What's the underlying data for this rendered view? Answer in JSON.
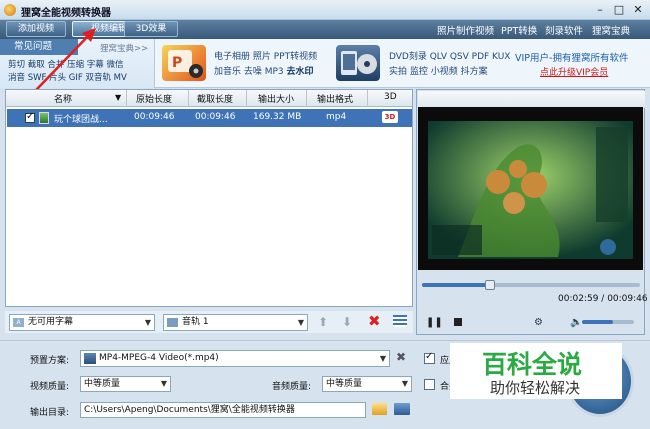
{
  "window": {
    "title": "狸窝全能视频转换器"
  },
  "toolbar": {
    "buttons": [
      "添加视频",
      "视频编辑",
      "3D效果"
    ],
    "links": [
      "照片制作视频",
      "PPT转换",
      "刻录软件",
      "狸窝宝典"
    ]
  },
  "faq": {
    "tab": "常见问题",
    "link": "狸窝宝典>>",
    "line1": "剪切 截取 合并 压缩 字幕 微信",
    "line2": "消音 SWF 片头 GIF 双音轨 MV"
  },
  "promo": {
    "a_line1": "电子相册 照片 PPT转视频",
    "a_line2a": "加音乐 去噪 MP3",
    "a_line2b": "去水印",
    "b_line1": "DVD刻录 QLV QSV PDF KUX",
    "b_line2": "实拍 监控 小视频 抖方案",
    "vip_line1": "VIP用户-拥有狸窝所有软件",
    "vip_line2": "点此升级VIP会员"
  },
  "file_list": {
    "headers": [
      "名称",
      "原始长度",
      "截取长度",
      "输出大小",
      "输出格式",
      "3D"
    ],
    "rows": [
      {
        "name": "玩个球团战...",
        "original": "00:09:46",
        "cut": "00:09:46",
        "size": "169.32 MB",
        "format": "mp4",
        "threed": "3D"
      }
    ]
  },
  "list_controls": {
    "subtitle": "无可用字幕",
    "audio": "音轨 1"
  },
  "player": {
    "time_current": "00:02:59",
    "time_total": "00:09:46",
    "separator": " / ",
    "progress": 0.31,
    "volume": 0.6
  },
  "output_settings": {
    "preset_label": "预置方案:",
    "preset_value": "MP4-MPEG-4 Video(*.mp4)",
    "video_quality_label": "视频质量:",
    "video_quality_value": "中等质量",
    "audio_quality_label": "音频质量:",
    "audio_quality_value": "中等质量",
    "output_dir_label": "输出目录:",
    "output_dir_value": "C:\\Users\\Apeng\\Documents\\狸窝\\全能视频转换器",
    "apply_label": "应用到",
    "merge_label": "合并成"
  },
  "watermark": {
    "big": "百科全说",
    "small": "助你轻松解决"
  },
  "colors": {
    "accent": "#3e73b7",
    "toolbar": "#38597a",
    "red": "#e02020"
  }
}
